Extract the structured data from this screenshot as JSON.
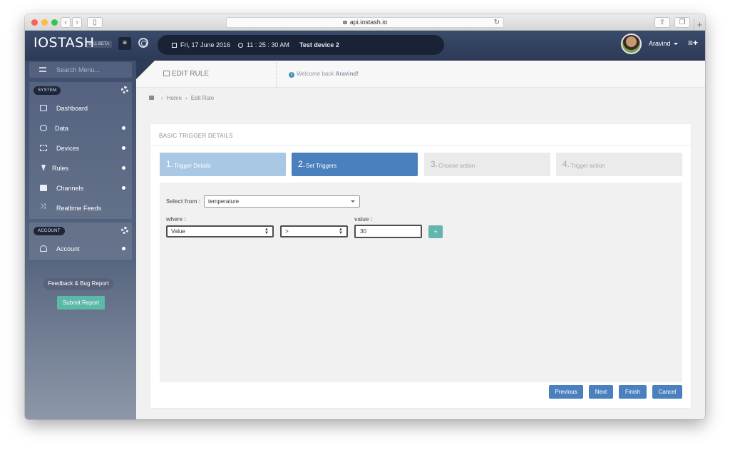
{
  "browser": {
    "url": "api.iostash.io"
  },
  "header": {
    "logo": "IOSTASH",
    "version": "V0.1 BETA",
    "date": "Fri, 17 June 2016",
    "time": "11 : 25 : 30 AM",
    "device": "Test device 2",
    "user": "Aravind"
  },
  "sidebar": {
    "search_placeholder": "Search Menu...",
    "system_label": "SYSTEM",
    "system_items": [
      {
        "label": "Dashboard"
      },
      {
        "label": "Data"
      },
      {
        "label": "Devices"
      },
      {
        "label": "Rules"
      },
      {
        "label": "Channels"
      },
      {
        "label": "Realtime Feeds"
      }
    ],
    "account_label": "ACCOUNT",
    "account_items": [
      {
        "label": "Account"
      }
    ],
    "feedback_label": "Feedback & Bug Report",
    "submit_label": "Submit Report"
  },
  "page": {
    "title": "EDIT RULE",
    "welcome_prefix": "Welcome back",
    "welcome_name": "Aravind!",
    "breadcrumb": [
      "Home",
      "Edit Rule"
    ]
  },
  "card": {
    "title": "BASIC TRIGGER DETAILS",
    "steps": [
      {
        "num": "1.",
        "label": "Trigger Details",
        "state": "done"
      },
      {
        "num": "2.",
        "label": "Set Triggers",
        "state": "active"
      },
      {
        "num": "3.",
        "label": "Choose action",
        "state": "idle"
      },
      {
        "num": "4.",
        "label": "Trigger action",
        "state": "idle"
      }
    ],
    "select_from_label": "Select from :",
    "select_from_value": "temperature",
    "where_label": "where :",
    "where_field": "Value",
    "operator": ">",
    "value_label": "value :",
    "value": "30",
    "add_label": "+",
    "buttons": {
      "previous": "Previous",
      "next": "Next",
      "finish": "Finish",
      "cancel": "Cancel"
    }
  },
  "colors": {
    "accent": "#4a80bd",
    "accent_light": "#a9c8e3",
    "teal": "#64b6ad",
    "topbar": "#2c3a56"
  }
}
